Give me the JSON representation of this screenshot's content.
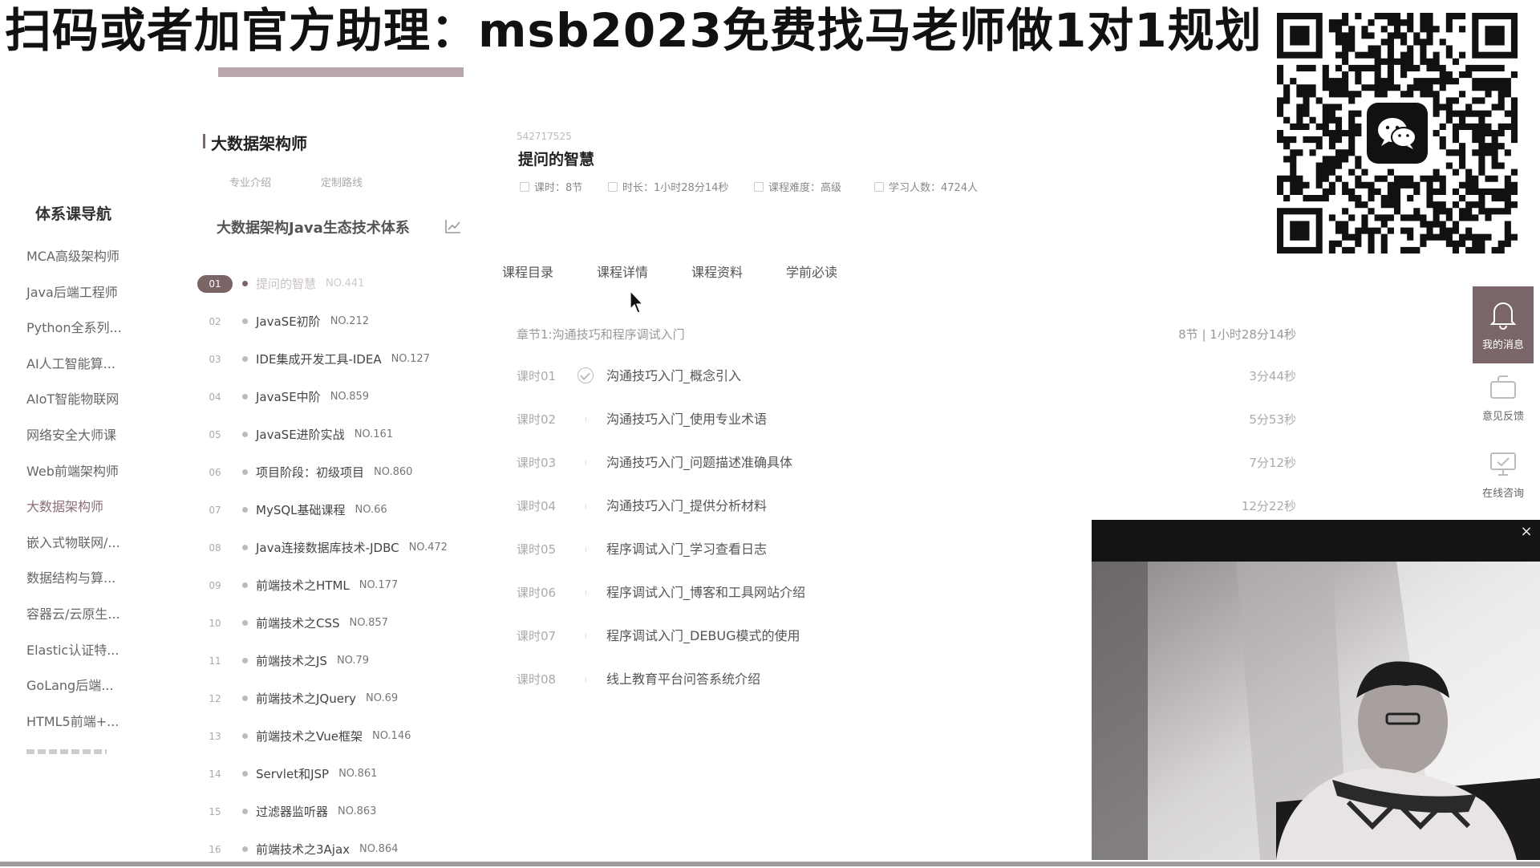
{
  "banner": {
    "text": "扫码或者加官方助理：msb2023免费找马老师做1对1规划"
  },
  "sidebar": {
    "title": "体系课导航",
    "items": [
      {
        "label": "MCA高级架构师"
      },
      {
        "label": "Java后端工程师"
      },
      {
        "label": "Python全系列..."
      },
      {
        "label": "AI人工智能算..."
      },
      {
        "label": "AIoT智能物联网"
      },
      {
        "label": "网络安全大师课"
      },
      {
        "label": "Web前端架构师"
      },
      {
        "label": "大数据架构师",
        "active": true
      },
      {
        "label": "嵌入式物联网/..."
      },
      {
        "label": "数据结构与算..."
      },
      {
        "label": "容器云/云原生..."
      },
      {
        "label": "Elastic认证特..."
      },
      {
        "label": "GoLang后端..."
      },
      {
        "label": "HTML5前端+..."
      }
    ]
  },
  "path": {
    "title": "大数据架构师",
    "sub_links": [
      "专业介绍",
      "定制路线"
    ],
    "system_title": "大数据架构Java生态技术体系",
    "courses": [
      {
        "num": "01",
        "name": "提问的智慧",
        "no": "NO.441",
        "active": true
      },
      {
        "num": "02",
        "name": "JavaSE初阶",
        "no": "NO.212"
      },
      {
        "num": "03",
        "name": "IDE集成开发工具-IDEA",
        "no": "NO.127"
      },
      {
        "num": "04",
        "name": "JavaSE中阶",
        "no": "NO.859"
      },
      {
        "num": "05",
        "name": "JavaSE进阶实战",
        "no": "NO.161"
      },
      {
        "num": "06",
        "name": "项目阶段：初级项目",
        "no": "NO.860"
      },
      {
        "num": "07",
        "name": "MySQL基础课程",
        "no": "NO.66"
      },
      {
        "num": "08",
        "name": "Java连接数据库技术-JDBC",
        "no": "NO.472"
      },
      {
        "num": "09",
        "name": "前端技术之HTML",
        "no": "NO.177"
      },
      {
        "num": "10",
        "name": "前端技术之CSS",
        "no": "NO.857"
      },
      {
        "num": "11",
        "name": "前端技术之JS",
        "no": "NO.79"
      },
      {
        "num": "12",
        "name": "前端技术之JQuery",
        "no": "NO.69"
      },
      {
        "num": "13",
        "name": "前端技术之Vue框架",
        "no": "NO.146"
      },
      {
        "num": "14",
        "name": "Servlet和JSP",
        "no": "NO.861"
      },
      {
        "num": "15",
        "name": "过滤器监听器",
        "no": "NO.863"
      },
      {
        "num": "16",
        "name": "前端技术之3Ajax",
        "no": "NO.864"
      }
    ]
  },
  "course": {
    "id": "542717525",
    "name": "提问的智慧",
    "meta": {
      "lessons": "课时：8节",
      "duration": "时长：1小时28分14秒",
      "difficulty": "课程难度：高级",
      "learners": "学习人数：4724人"
    },
    "tabs": [
      "课程目录",
      "课程详情",
      "课程资料",
      "学前必读"
    ],
    "chapter": {
      "title": "章节1:沟通技巧和程序调试入门",
      "summary": "8节 | 1小时28分14秒"
    },
    "lessons": [
      {
        "no": "课时01",
        "name": "沟通技巧入门_概念引入",
        "duration": "3分44秒",
        "done": true
      },
      {
        "no": "课时02",
        "name": "沟通技巧入门_使用专业术语",
        "duration": "5分53秒"
      },
      {
        "no": "课时03",
        "name": "沟通技巧入门_问题描述准确具体",
        "duration": "7分12秒"
      },
      {
        "no": "课时04",
        "name": "沟通技巧入门_提供分析材料",
        "duration": "12分22秒"
      },
      {
        "no": "课时05",
        "name": "程序调试入门_学习查看日志",
        "duration": ""
      },
      {
        "no": "课时06",
        "name": "程序调试入门_博客和工具网站介绍",
        "duration": ""
      },
      {
        "no": "课时07",
        "name": "程序调试入门_DEBUG模式的使用",
        "duration": ""
      },
      {
        "no": "课时08",
        "name": "线上教育平台问答系统介绍",
        "duration": ""
      }
    ]
  },
  "rail": {
    "messages": "我的消息",
    "feedback": "意见反馈",
    "consult": "在线咨询"
  },
  "video": {
    "close_symbol": "×"
  },
  "colors": {
    "accent": "#7a6466",
    "text": "#333333",
    "muted": "#999999"
  }
}
